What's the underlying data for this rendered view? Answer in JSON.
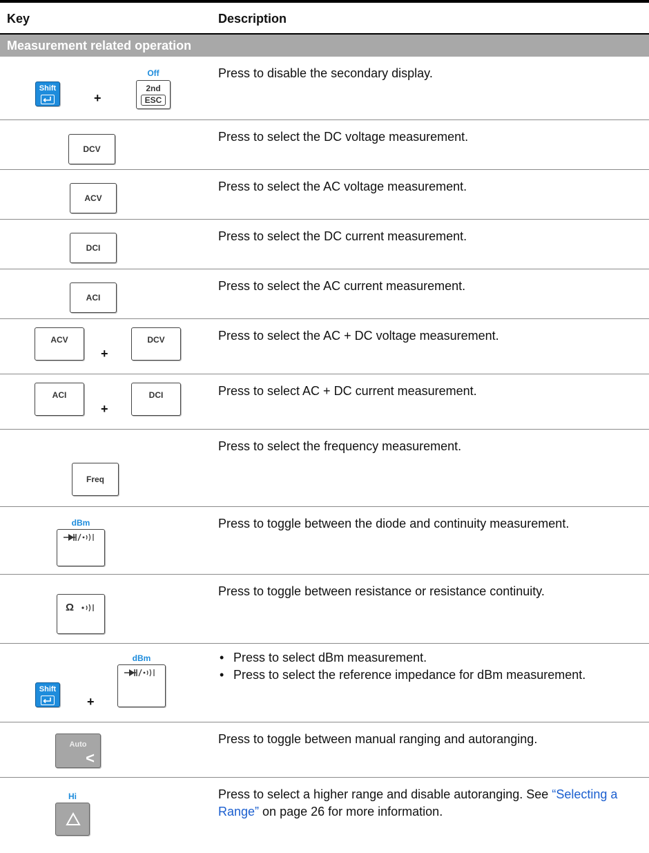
{
  "header": {
    "key": "Key",
    "description": "Description"
  },
  "section": {
    "title": "Measurement related operation"
  },
  "colors": {
    "shift_key": "#1e8cdc",
    "label_blue": "#1e8cdc",
    "section_bg": "#a8a8a8",
    "link": "#1a5ecf"
  },
  "rows": [
    {
      "shift": "Shift",
      "plus": "+",
      "above": "Off",
      "key_top": "2nd",
      "key_bottom": "ESC",
      "desc": "Press to disable the secondary display."
    },
    {
      "key": "DCV",
      "desc": "Press to select the DC voltage measurement."
    },
    {
      "key": "ACV",
      "desc": "Press to select the AC voltage measurement."
    },
    {
      "key": "DCI",
      "desc": "Press to select the DC current measurement."
    },
    {
      "key": "ACI",
      "desc": "Press to select the AC current measurement."
    },
    {
      "key1": "ACV",
      "plus": "+",
      "key2": "DCV",
      "desc": "Press to select the AC + DC voltage measurement."
    },
    {
      "key1": "ACI",
      "plus": "+",
      "key2": "DCI",
      "desc": "Press to select AC + DC current measurement."
    },
    {
      "key": "Freq",
      "desc": "Press to select the frequency measurement."
    },
    {
      "above": "dBm",
      "icon": "diode-continuity-icon",
      "desc": "Press to toggle between the diode and continuity measurement."
    },
    {
      "key": "Ω",
      "icon": "continuity-beeper-icon",
      "desc": "Press to toggle between resistance or resistance continuity."
    },
    {
      "shift": "Shift",
      "plus": "+",
      "above": "dBm",
      "icon": "diode-continuity-icon",
      "bullets": [
        "Press to select dBm measurement.",
        "Press to select the reference impedance for dBm measurement."
      ]
    },
    {
      "key_top": "Auto",
      "key_bottom": "<",
      "desc": "Press to toggle between manual ranging and autoranging."
    },
    {
      "above": "Hi",
      "icon": "up-triangle-icon",
      "desc_before": "Press to select a higher range and disable autoranging. See",
      "link": "“Selecting a Range”",
      "desc_after": " on page 26 for more information."
    }
  ]
}
